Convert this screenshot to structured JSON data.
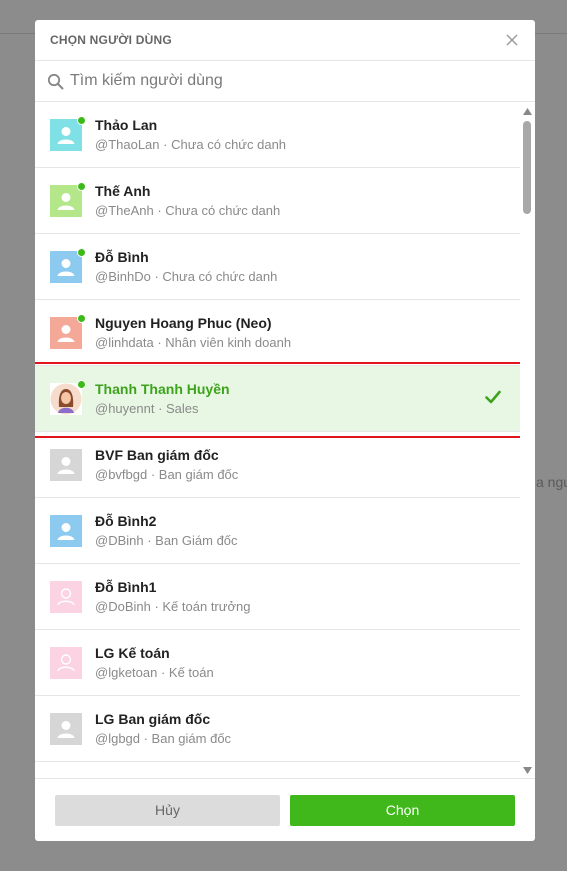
{
  "background": {
    "partial_text": "a ngu"
  },
  "dialog": {
    "title": "CHỌN NGƯỜI DÙNG",
    "search_placeholder": "Tìm kiếm người dùng"
  },
  "colors": {
    "accent": "#40b81c",
    "online": "#3dba19",
    "highlight_border": "#e0141a",
    "selected_bg": "#e8f6e4"
  },
  "users": [
    {
      "name": "Thảo Lan",
      "subtitle": "@ThaoLan · Chưa có chức danh",
      "avatar_color": "#7fe0e6",
      "online": true,
      "selected": false
    },
    {
      "name": "Thế Anh",
      "subtitle": "@TheAnh · Chưa có chức danh",
      "avatar_color": "#b4e68a",
      "online": true,
      "selected": false
    },
    {
      "name": "Đỗ Bình",
      "subtitle": "@BinhDo · Chưa có chức danh",
      "avatar_color": "#8ccaf0",
      "online": true,
      "selected": false
    },
    {
      "name": "Nguyen Hoang Phuc (Neo)",
      "subtitle": "@linhdata · Nhân viên kinh doanh",
      "avatar_color": "#f4a898",
      "online": true,
      "selected": false
    },
    {
      "name": "Thanh Thanh Huyền",
      "subtitle": "@huyennt · Sales",
      "avatar_color": "photo",
      "online": true,
      "selected": true
    },
    {
      "name": "BVF Ban giám đốc",
      "subtitle": "@bvfbgd · Ban giám đốc",
      "avatar_color": "#d6d6d6",
      "online": false,
      "selected": false
    },
    {
      "name": "Đỗ Bình2",
      "subtitle": "@DBinh · Ban Giám đốc",
      "avatar_color": "#8ccaf0",
      "online": false,
      "selected": false
    },
    {
      "name": "Đỗ Bình1",
      "subtitle": "@DoBinh · Kế toán trưởng",
      "avatar_color": "#fbd3e3",
      "online": false,
      "selected": false
    },
    {
      "name": "LG Kế toán",
      "subtitle": "@lgketoan · Kế toán",
      "avatar_color": "#fbd3e3",
      "online": false,
      "selected": false
    },
    {
      "name": "LG Ban giám đốc",
      "subtitle": "@lgbgd · Ban giám đốc",
      "avatar_color": "#d6d6d6",
      "online": false,
      "selected": false
    }
  ],
  "footer": {
    "cancel_label": "Hủy",
    "confirm_label": "Chọn"
  }
}
